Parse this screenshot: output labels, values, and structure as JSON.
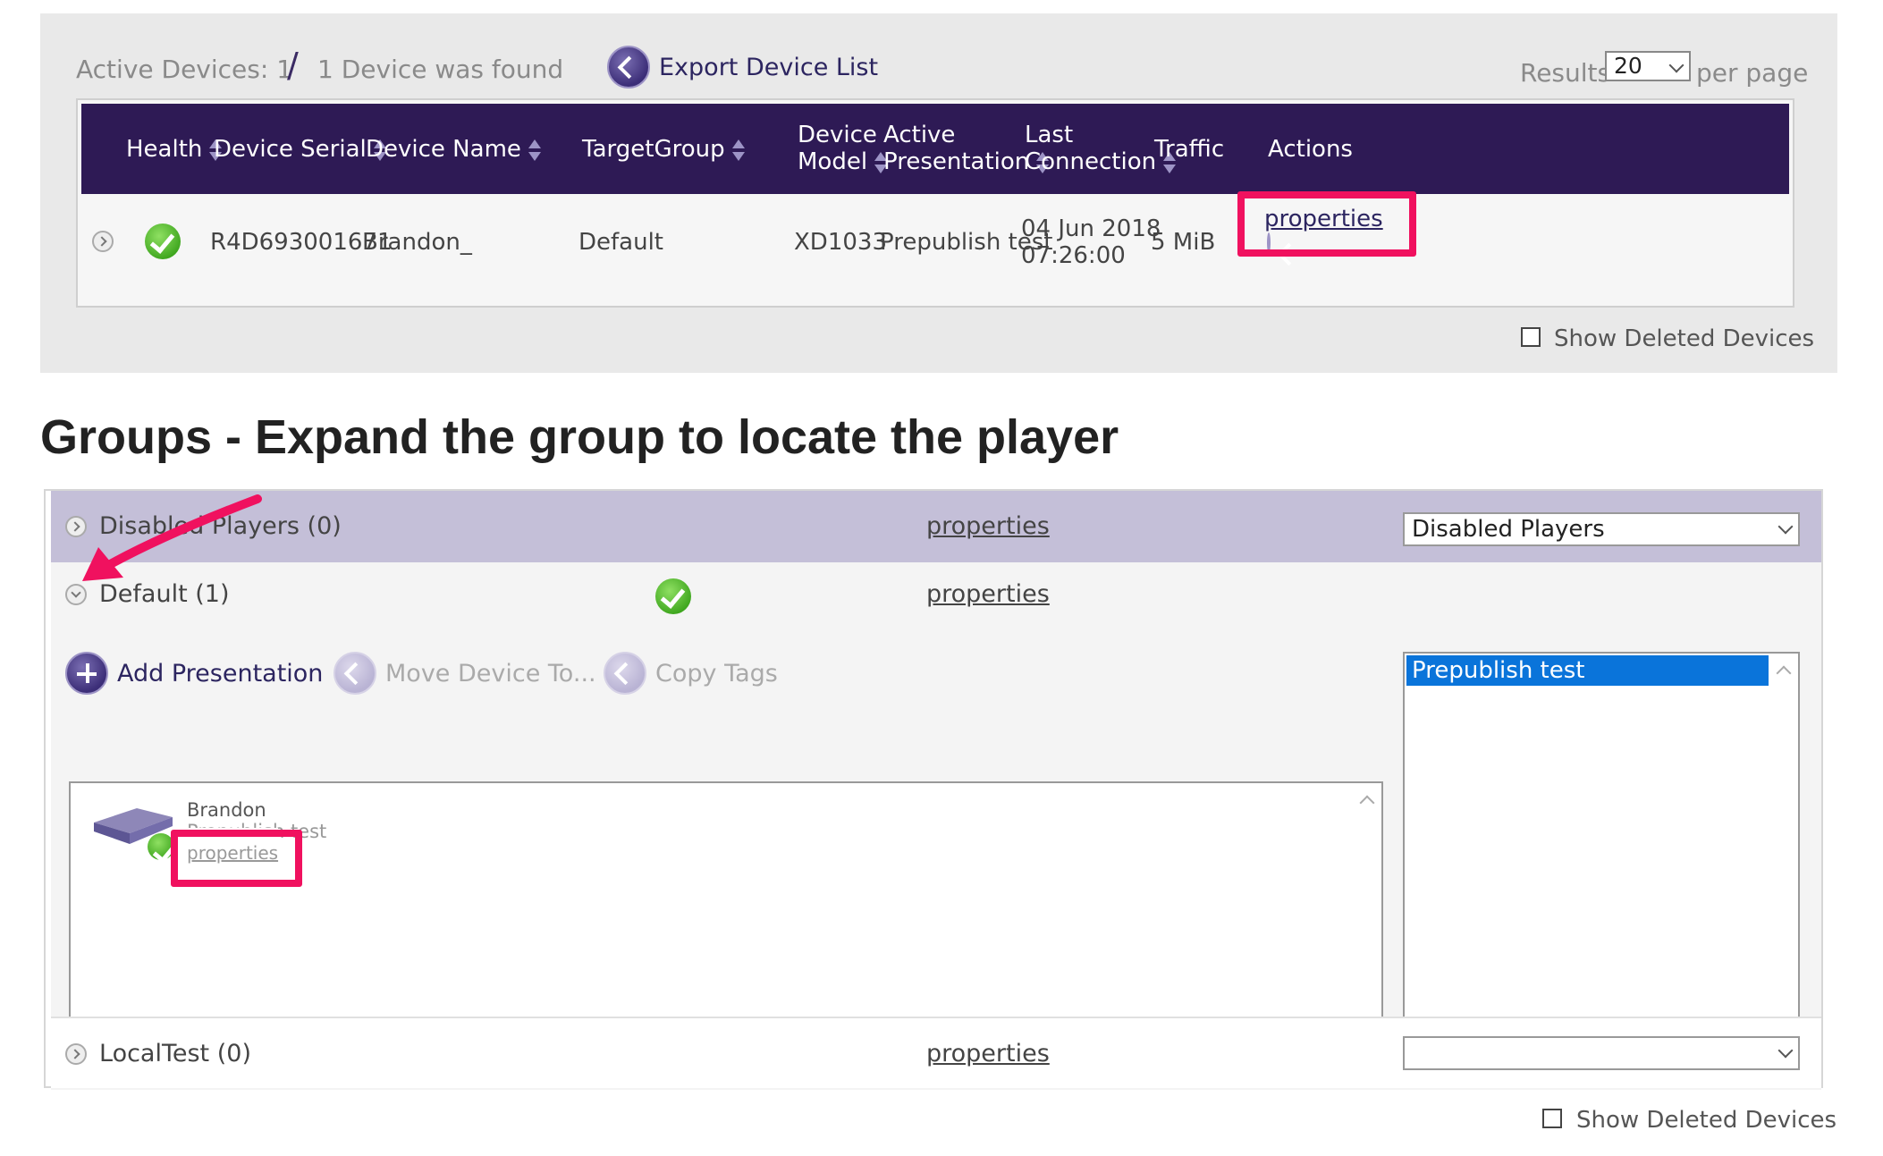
{
  "devices_panel": {
    "active_devices": "Active Devices: 1",
    "slash": "/",
    "found": "1 Device was found",
    "export_label": "Export Device List",
    "results_label": "Results",
    "results_value": "20",
    "per_page": "per page",
    "show_deleted": "Show Deleted Devices",
    "headers": {
      "health": "Health",
      "serial": "Device Serial",
      "name": "Device Name",
      "target_group": "TargetGroup",
      "model_line1": "Device",
      "model_line2": "Model",
      "pres_line1": "Active",
      "pres_line2": "Presentation",
      "conn_line1": "Last",
      "conn_line2": "Connection",
      "traffic": "Traffic",
      "actions": "Actions"
    },
    "row": {
      "serial": "R4D693001671",
      "name": "Brandon_",
      "target_group": "Default",
      "model": "XD1033",
      "presentation": "Prepublish test",
      "conn_date": "04 Jun 2018",
      "conn_time": "07:26:00",
      "traffic": "5 MiB",
      "action_link": "properties"
    }
  },
  "heading": "Groups - Expand the group to locate the player",
  "groups": {
    "disabled": {
      "name": "Disabled Players (0)",
      "link": "properties",
      "select_value": "Disabled Players"
    },
    "default": {
      "name": "Default (1)",
      "link": "properties",
      "add_presentation": "Add Presentation",
      "move_device": "Move Device To...",
      "copy_tags": "Copy Tags",
      "player_name": "Brandon",
      "player_sub": "Prepublish test",
      "player_link": "properties",
      "presentation_selected": "Prepublish test"
    },
    "localtest": {
      "name": "LocalTest (0)",
      "link": "properties",
      "select_value": ""
    },
    "show_deleted": "Show Deleted Devices"
  },
  "colors": {
    "header_bg": "#2e1a55",
    "highlight": "#f0115f",
    "selected": "#0a74da",
    "disabled_row": "#c4bfd8"
  }
}
